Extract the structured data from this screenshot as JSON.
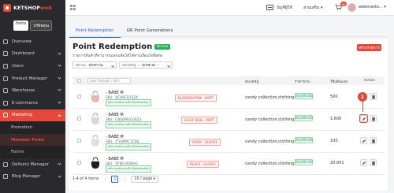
{
  "brand": {
    "name_main": "KETSHOP",
    "name_script": "web",
    "accent": "#e4483a"
  },
  "sidebar": {
    "pills": [
      "Items",
      "บริษัทคุณ"
    ],
    "items": [
      {
        "label": "Overview",
        "icon": "overview-icon"
      },
      {
        "label": "Dashboard",
        "icon": "dashboard-icon"
      },
      {
        "label": "Users",
        "icon": "users-icon"
      },
      {
        "label": "Product Manager",
        "icon": "product-icon"
      },
      {
        "label": "Warehouse",
        "icon": "warehouse-icon"
      },
      {
        "label": "E-commerce",
        "icon": "ecommerce-icon"
      },
      {
        "label": "Marketing",
        "icon": "marketing-icon"
      }
    ],
    "marketing_sub": [
      "Promotion",
      "Member Point",
      "Forms"
    ],
    "bottom_items": [
      {
        "label": "Delivery Manager",
        "icon": "delivery-icon"
      },
      {
        "label": "Blog Manager",
        "icon": "blog-icon"
      }
    ]
  },
  "topbar": {
    "lang": "บัญชีผู้ใช้",
    "currency": "ส่วนเสริม",
    "cart_count": "99",
    "user": "webmaste..."
  },
  "tabs": [
    "Point Redemption",
    "QR Point Generations"
  ],
  "page": {
    "title": "Point Redemption",
    "status": "Online",
    "subtitle": "รายการสินค้าที่สามารถแลกแต้มได้ได้ตามเงื่อนไขพิเศษ",
    "create_label": "สร้างรายการ"
  },
  "filters": [
    {
      "label": "สถานะ",
      "value": "ทุกสถานะ"
    },
    {
      "label": "หมวดหมู่",
      "value": "-- ทุกหมวด --"
    }
  ],
  "table": {
    "search_placeholder": "ค้นหาชื่อสินค้า, SKU",
    "headers": {
      "category": "หมวดหมู่",
      "price": "ราคาขาย",
      "qty": "ใช้แต้มแลก",
      "action": "Action"
    },
    "rows": [
      {
        "name": "- BABE M",
        "sku": "SKU : BCHBCB15ZX",
        "tag": "หลักเกณฑ์แลกแต้ม Redemption",
        "variant": "BLOSSOM PINK - MATT",
        "category": "candy collection,clothing,กระเป๋า",
        "price": "20,000.00",
        "qty": "500",
        "bag_color": "#e9b6b0"
      },
      {
        "name": "- BABE M",
        "sku": "SKU : CBSDMGCG6Z3",
        "tag": "หลักเกณฑ์แลกแต้ม Redemption",
        "variant": "LIGHT BLUE - MATT",
        "category": "candy collection,clothing,กระเป๋า",
        "price": "20,000.00",
        "qty": "1,600",
        "bag_color": "#d9d9d9"
      },
      {
        "name": "- BABE M",
        "sku": "SKU : IT1B9MCTG5B",
        "tag": "หลักเกณฑ์แลกแต้ม Redemption",
        "variant": "IVORY - GLOSSY",
        "category": "candy collection,clothing,กระเป๋า",
        "price": "20,000.00",
        "qty": "100",
        "bag_color": "#e6e0d4"
      },
      {
        "name": "- BABE M",
        "sku": "SKU : VF8FLAGNHG",
        "tag": "หลักเกณฑ์แลกแต้ม Redemption",
        "variant": "BLACK - GLOSSY",
        "category": "candy collection,clothing,กระเป๋า",
        "price": "20,000.00",
        "qty": "20,001",
        "bag_color": "#1d1d1d"
      }
    ]
  },
  "pager": {
    "summary": "1-4 of 4 items",
    "current": "1",
    "page_size": "10 / page"
  },
  "callout": "1"
}
